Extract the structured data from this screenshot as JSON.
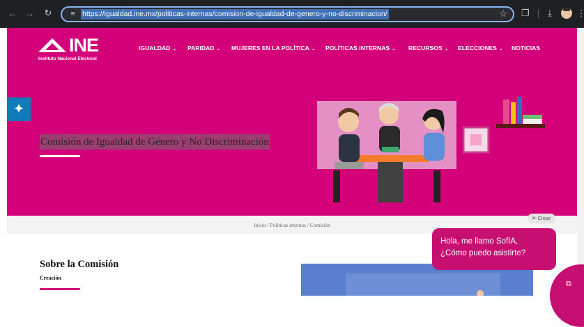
{
  "browser": {
    "url": "https://igualdad.ine.mx/politicas-internas/comision-de-igualdad-de-genero-y-no-discriminacion/",
    "icons": [
      "back-icon",
      "forward-icon",
      "reload-icon",
      "site-info-icon",
      "star-icon",
      "extensions-icon",
      "download-icon",
      "profile-icon",
      "menu-icon"
    ]
  },
  "header": {
    "logo_text": "INE",
    "logo_subtitle": "Instituto Nacional Electoral",
    "brand_color": "#d4007a",
    "nav": [
      {
        "label": "IGUALDAD",
        "dropdown": true
      },
      {
        "label": "PARIDAD",
        "dropdown": true
      },
      {
        "label": "MUJERES EN LA POLÍTICA",
        "dropdown": true
      },
      {
        "label": "POLÍTICAS INTERNAS",
        "dropdown": true
      },
      {
        "label": "RECURSOS",
        "dropdown": true
      },
      {
        "label": "ELECCIONES",
        "dropdown": true
      },
      {
        "label": "NOTICIAS",
        "dropdown": false
      }
    ]
  },
  "hero": {
    "title": "Comisión de Igualdad de Género y No Discriminación"
  },
  "breadcrumb": "Inicio / Políticas internas / Comisión",
  "section": {
    "title": "Sobre la Comisión",
    "subtitle": "Creación"
  },
  "chat": {
    "close_label": "✕ Close",
    "message_line1": "Hola, me llamo SofIA,",
    "message_line2": "¿Cómo puedo asistirte?",
    "color": "#c70f72"
  },
  "accessibility_color": "#0f7bb8"
}
